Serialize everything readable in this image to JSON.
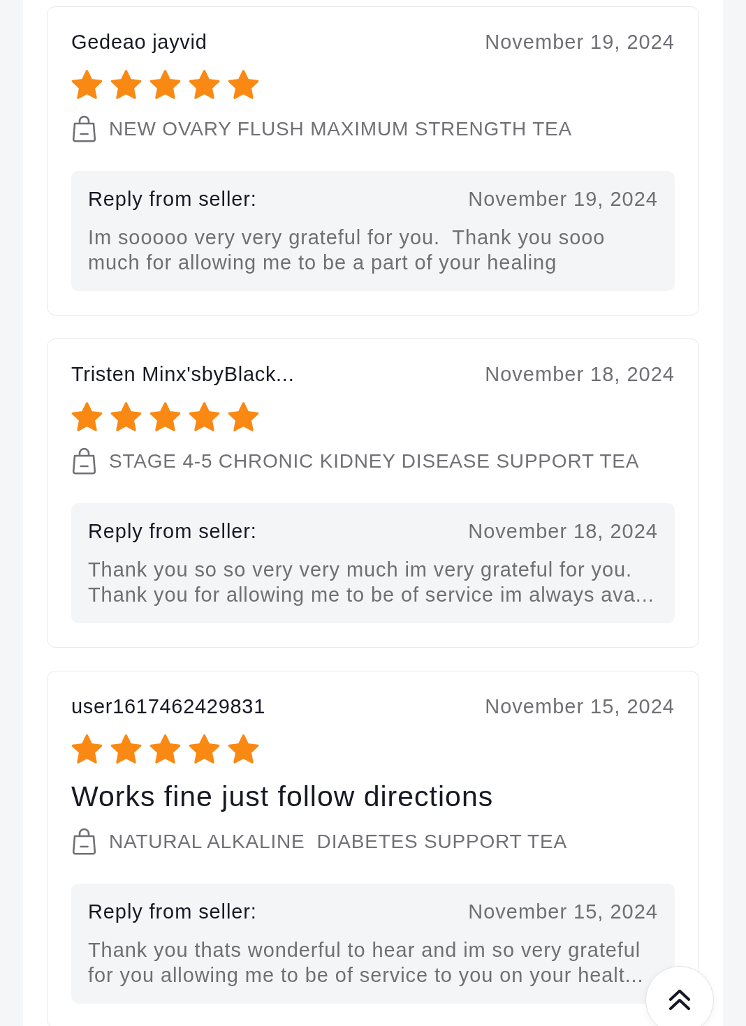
{
  "reviews": [
    {
      "author": "Gedeao jayvid",
      "date": "November 19, 2024",
      "stars": 5,
      "product": "NEW OVARY FLUSH MAXIMUM STRENGTH TEA",
      "reply": {
        "label": "Reply from seller:",
        "date": "November 19, 2024",
        "text": "Im sooooo very very grateful for you.  Thank you sooo much for allowing me to be a part of your healing"
      }
    },
    {
      "author": "Tristen Minx'sbyBlack...",
      "date": "November 18, 2024",
      "stars": 5,
      "product": "STAGE 4-5 CHRONIC KIDNEY DISEASE SUPPORT TEA",
      "reply": {
        "label": "Reply from seller:",
        "date": "November 18, 2024",
        "text": "Thank you so so very very much im very grateful for you. Thank you for allowing me to be of service im always ava..."
      }
    },
    {
      "author": "user1617462429831",
      "date": "November 15, 2024",
      "stars": 5,
      "title": "Works fine just follow directions",
      "product": "NATURAL ALKALINE  DIABETES SUPPORT TEA",
      "reply": {
        "label": "Reply from seller:",
        "date": "November 15, 2024",
        "text": "Thank you thats wonderful to hear and im so very grateful for you allowing me to be of service to you on your healt..."
      }
    }
  ]
}
